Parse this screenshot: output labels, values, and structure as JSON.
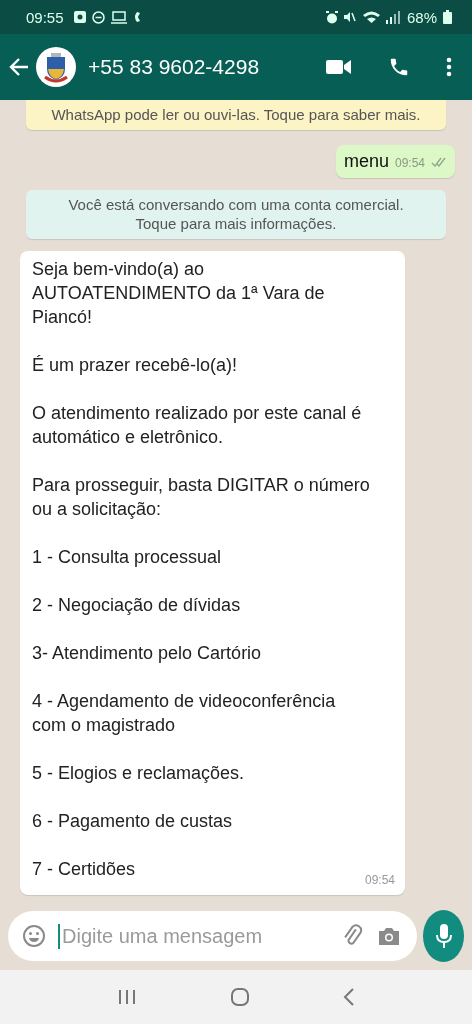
{
  "status_bar": {
    "time": "09:55",
    "battery": "68%"
  },
  "header": {
    "contact": "+55 83 9602-4298"
  },
  "messages": [
    {
      "kind": "encryption_notice",
      "lines": [
        "WhatsApp pode ler ou ouvi-las. Toque para saber mais."
      ]
    },
    {
      "kind": "outgoing",
      "text": "menu",
      "time": "09:54",
      "read": false
    },
    {
      "kind": "business_notice",
      "lines": [
        "Você está conversando com uma conta comercial.",
        "Toque para mais informações."
      ]
    },
    {
      "kind": "incoming",
      "time": "09:54",
      "paragraphs": [
        [
          "Seja bem-vindo(a) ao",
          "AUTOATENDIMENTO da 1ª Vara de",
          "Piancó!"
        ],
        [
          "É um prazer recebê-lo(a)!"
        ],
        [
          "O atendimento realizado por este canal é",
          "automático e eletrônico."
        ],
        [
          "Para prosseguir, basta DIGITAR o número",
          "ou a solicitação:"
        ],
        [
          "1 - Consulta processual"
        ],
        [
          "2 - Negociação de dívidas"
        ],
        [
          "3- Atendimento pelo Cartório"
        ],
        [
          "4 - Agendamento de videoconferência",
          "com o magistrado"
        ],
        [
          "5 - Elogios e reclamações."
        ],
        [
          "6 - Pagamento de custas"
        ],
        [
          "7 - Certidões"
        ]
      ]
    }
  ],
  "composer": {
    "placeholder": "Digite uma mensagem"
  }
}
